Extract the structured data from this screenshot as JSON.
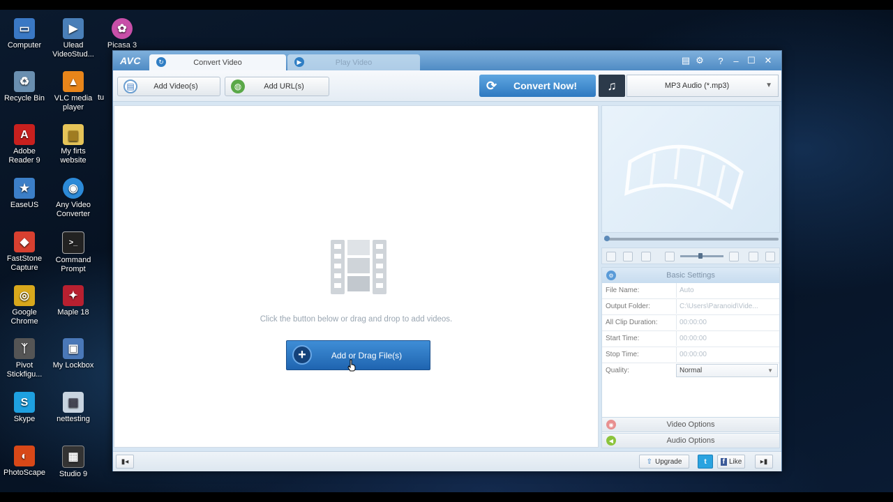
{
  "desktop": {
    "icons": [
      {
        "label": "Computer",
        "icon": "computer-icon",
        "color": "#3a78c4",
        "glyph": "▭"
      },
      {
        "label": "Ulead VideoStud...",
        "icon": "ulead-videostudio-icon",
        "color": "#4a7fb8",
        "glyph": "▶"
      },
      {
        "label": "Picasa 3",
        "icon": "picasa-icon",
        "color": "#c84fa8",
        "glyph": "✿"
      },
      {
        "label": "Recycle Bin",
        "icon": "recycle-bin-icon",
        "color": "#6a8fb0",
        "glyph": "♻"
      },
      {
        "label": "VLC media player",
        "icon": "vlc-icon",
        "color": "#e8851a",
        "glyph": "▲"
      },
      {
        "label": "Adobe Reader 9",
        "icon": "adobe-reader-icon",
        "color": "#c8201e",
        "glyph": "A"
      },
      {
        "label": "My firts website",
        "icon": "folder-icon",
        "color": "#e6c458",
        "glyph": "▆"
      },
      {
        "label": "EaseUS",
        "icon": "easeus-icon",
        "color": "#3c7fc8",
        "glyph": "★"
      },
      {
        "label": "Any Video Converter",
        "icon": "any-video-converter-icon",
        "color": "#2c8ad8",
        "glyph": "◉"
      },
      {
        "label": "FastStone Capture",
        "icon": "faststone-icon",
        "color": "#d84030",
        "glyph": "◆"
      },
      {
        "label": "Command Prompt",
        "icon": "command-prompt-icon",
        "color": "#222222",
        "glyph": ">_"
      },
      {
        "label": "Google Chrome",
        "icon": "chrome-icon",
        "color": "#d8a81c",
        "glyph": "◎"
      },
      {
        "label": "Maple 18",
        "icon": "maple-icon",
        "color": "#b82030",
        "glyph": "✦"
      },
      {
        "label": "Pivot Stickfigu...",
        "icon": "pivot-icon",
        "color": "#555555",
        "glyph": "ᛉ"
      },
      {
        "label": "My Lockbox",
        "icon": "lockbox-icon",
        "color": "#4a78b8",
        "glyph": "▣"
      },
      {
        "label": "Skype",
        "icon": "skype-icon",
        "color": "#1ea0e0",
        "glyph": "S"
      },
      {
        "label": "nettesting",
        "icon": "nettesting-icon",
        "color": "#c8d4e0",
        "glyph": "▤"
      },
      {
        "label": "PhotoScape",
        "icon": "photoscape-icon",
        "color": "#d84818",
        "glyph": "◐"
      },
      {
        "label": "Studio 9",
        "icon": "studio-icon",
        "color": "#333333",
        "glyph": "▦"
      }
    ],
    "partial_label": "tu"
  },
  "app": {
    "logo": "AVC",
    "tabs": [
      {
        "label": "Convert Video"
      },
      {
        "label": "Play Video"
      }
    ],
    "window_controls": {
      "settings": "⚙",
      "help": "?",
      "minimize": "–",
      "maximize": "☐",
      "close": "✕",
      "skin": "▤"
    }
  },
  "toolbar": {
    "add_videos": "Add Video(s)",
    "add_url": "Add URL(s)",
    "convert_now": "Convert Now!",
    "format": "MP3 Audio (*.mp3)"
  },
  "filearea": {
    "hint": "Click the button below or drag and drop to add videos.",
    "add_button": "Add or Drag File(s)"
  },
  "settings": {
    "header": "Basic Settings",
    "rows": [
      {
        "label": "File Name:",
        "value": "Auto"
      },
      {
        "label": "Output Folder:",
        "value": "C:\\Users\\Paranoid\\Vide..."
      },
      {
        "label": "All Clip Duration:",
        "value": "00:00:00"
      },
      {
        "label": "Start Time:",
        "value": "00:00:00"
      },
      {
        "label": "Stop Time:",
        "value": "00:00:00"
      },
      {
        "label": "Quality:",
        "value": "Normal"
      }
    ],
    "video_options": "Video Options",
    "audio_options": "Audio Options"
  },
  "statusbar": {
    "upgrade": "Upgrade",
    "twitter": "t",
    "like": "Like"
  },
  "colors": {
    "accent": "#2e79c1",
    "titlebar": "#4f8bc4",
    "video_options_icon": "#e89090",
    "audio_options_icon": "#8cc43c"
  }
}
